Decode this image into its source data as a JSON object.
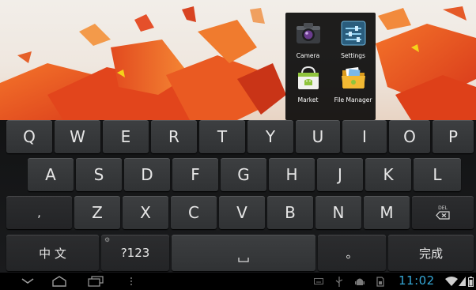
{
  "apps": [
    {
      "label": "Camera",
      "icon": "camera-icon"
    },
    {
      "label": "Settings",
      "icon": "settings-icon"
    },
    {
      "label": "Market",
      "icon": "market-icon"
    },
    {
      "label": "File Manager",
      "icon": "file-manager-icon"
    }
  ],
  "keyboard": {
    "row1": [
      "Q",
      "W",
      "E",
      "R",
      "T",
      "Y",
      "U",
      "I",
      "O",
      "P"
    ],
    "row2": [
      "A",
      "S",
      "D",
      "F",
      "G",
      "H",
      "J",
      "K",
      "L"
    ],
    "row3": {
      "comma": ",",
      "letters": [
        "Z",
        "X",
        "C",
        "V",
        "B",
        "N",
        "M"
      ],
      "delete_hint": "DEL"
    },
    "row4": {
      "language": "中 文",
      "symbols": "?123",
      "period": "。",
      "done": "完成"
    }
  },
  "status": {
    "time": "11:02"
  },
  "colors": {
    "accent_clock": "#35a7d6",
    "wallpaper_orange": "#e8501c"
  }
}
